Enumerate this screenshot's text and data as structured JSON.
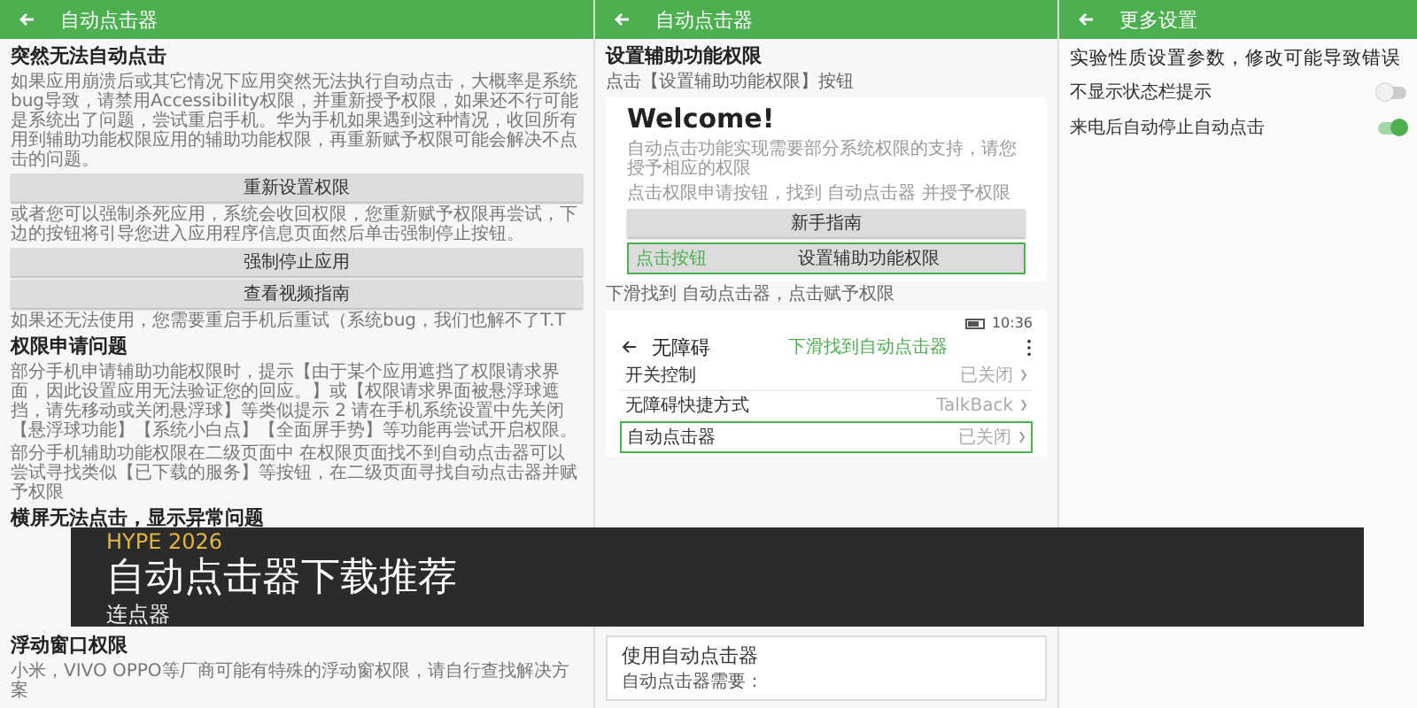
{
  "left_screen": {
    "title": "自动点击器",
    "items": [
      {
        "kind": "heading",
        "text": "突然无法自动点击"
      },
      {
        "kind": "paragraph",
        "text": "如果应用崩溃后或其它情况下应用突然无法执行自动点击，大概率是系统bug导致，请禁用Accessibility权限，并重新授予权限，如果还不行可能是系统出了问题，尝试重启手机。华为手机如果遇到这种情况，收回所有用到辅助功能权限应用的辅助功能权限，再重新赋予权限可能会解决不点击的问题。"
      },
      {
        "kind": "button",
        "text": "重新设置权限"
      },
      {
        "kind": "paragraph",
        "text": "或者您可以强制杀死应用，系统会收回权限，您重新赋予权限再尝试，下边的按钮将引导您进入应用程序信息页面然后单击强制停止按钮。"
      },
      {
        "kind": "button",
        "text": "强制停止应用"
      },
      {
        "kind": "button",
        "text": "查看视频指南"
      },
      {
        "kind": "paragraph",
        "text": "如果还无法使用，您需要重启手机后重试（系统bug，我们也解不了T.T"
      },
      {
        "kind": "heading",
        "text": "权限申请问题"
      },
      {
        "kind": "paragraph",
        "text": "部分手机申请辅助功能权限时，提示【由于某个应用遮挡了权限请求界面，因此设置应用无法验证您的回应。】或【权限请求界面被悬浮球遮挡，请先移动或关闭悬浮球】等类似提示 2 请在手机系统设置中先关闭【悬浮球功能】【系统小白点】【全面屏手势】等功能再尝试开启权限。"
      },
      {
        "kind": "paragraph",
        "text": "部分手机辅助功能权限在二级页面中 在权限页面找不到自动点击器可以尝试寻找类似【已下载的服务】等按钮，在二级页面寻找自动点击器并赋予权限"
      },
      {
        "kind": "heading",
        "text": "横屏无法点击，显示异常问题"
      }
    ],
    "items_below_banner": [
      {
        "kind": "heading",
        "text": "浮动窗口权限"
      },
      {
        "kind": "paragraph",
        "text": "小米，VIVO OPPO等厂商可能有特殊的浮动窗权限，请自行查找解决方案"
      }
    ]
  },
  "middle_screen": {
    "title": "自动点击器",
    "heading": "设置辅助功能权限",
    "subheading": "点击【设置辅助功能权限】按钮",
    "welcome": {
      "title": "Welcome!",
      "lines": [
        "自动点击功能实现需要部分系统权限的支持，请您授予相应的权限",
        "点击权限申请按钮，找到 自动点击器 并授予权限"
      ],
      "guide_button": "新手指南",
      "highlight_label": "点击按钮",
      "permission_button": "设置辅助功能权限"
    },
    "caption": "下滑找到 自动点击器，点击赋予权限",
    "phone": {
      "time": "10:36",
      "title": "无障碍",
      "hint": "下滑找到自动点击器",
      "rows": [
        {
          "label": "开关控制",
          "value": "已关闭",
          "highlighted": false
        },
        {
          "label": "无障碍快捷方式",
          "value": "TalkBack",
          "highlighted": false
        },
        {
          "label": "自动点击器",
          "value": "已关闭",
          "highlighted": true
        }
      ]
    },
    "card": {
      "title": "使用自动点击器",
      "line": "自动点击器需要："
    }
  },
  "right_screen": {
    "title": "更多设置",
    "note": "实验性质设置参数，修改可能导致错误",
    "toggles": [
      {
        "label": "不显示状态栏提示",
        "on": false
      },
      {
        "label": "来电后自动停止自动点击",
        "on": true
      }
    ]
  },
  "banner": {
    "tag": "HYPE 2026",
    "title": "自动点击器下载推荐",
    "subtitle": "连点器"
  }
}
